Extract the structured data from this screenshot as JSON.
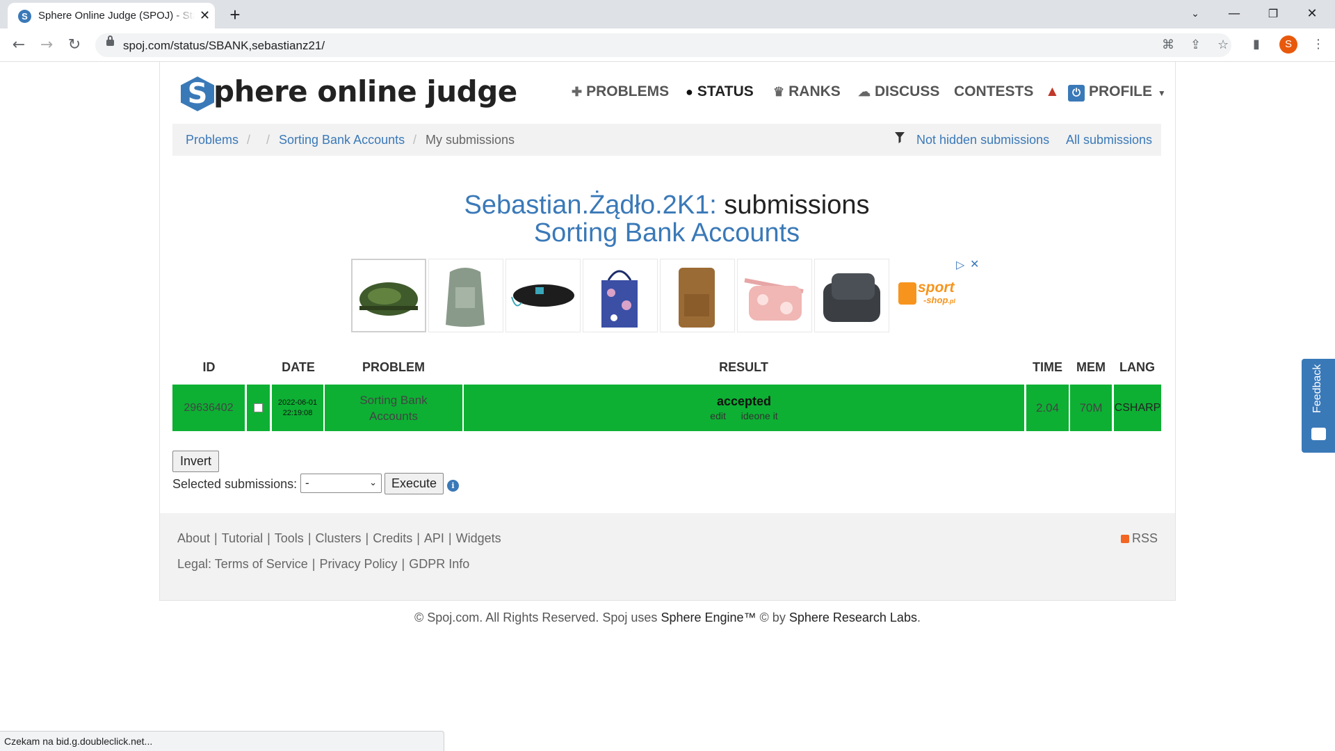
{
  "browser": {
    "tab_title": "Sphere Online Judge (SPOJ) - Status",
    "tab_favicon": "S",
    "new_tab_icon": "+",
    "url": "spoj.com/status/SBANK,sebastianz21/",
    "profile_initial": "S",
    "status_text": "Czekam na bid.g.doubleclick.net..."
  },
  "site": {
    "logo_letter": "S",
    "logo_text": "phere online judge",
    "nav": {
      "problems": "PROBLEMS",
      "status": "STATUS",
      "ranks": "RANKS",
      "discuss": "DISCUSS",
      "contests": "CONTESTS",
      "profile": "PROFILE"
    }
  },
  "breadcrumb": {
    "problems": "Problems",
    "sep1": "/",
    "sep2": "/",
    "problem": "Sorting Bank Accounts",
    "sep3": "/",
    "current": "My submissions",
    "filter_not_hidden": "Not hidden submissions",
    "filter_all": "All submissions"
  },
  "heading": {
    "user": "Sebastian.Żądło.2K1:",
    "suffix": "submissions",
    "problem": "Sorting Bank Accounts"
  },
  "ad": {
    "brand_line1": "sport",
    "brand_line2": "-shop",
    "brand_suffix": ".pl"
  },
  "table": {
    "headers": {
      "id": "ID",
      "date": "DATE",
      "problem": "PROBLEM",
      "result": "RESULT",
      "time": "TIME",
      "mem": "MEM",
      "lang": "LANG"
    },
    "rows": [
      {
        "id": "29636402",
        "date_line1": "2022-06-01",
        "date_line2": "22:19:08",
        "problem_line1": "Sorting Bank",
        "problem_line2": "Accounts",
        "result": "accepted",
        "action_edit": "edit",
        "action_ideone": "ideone it",
        "time": "2.04",
        "mem": "70M",
        "lang": "CSHARP"
      }
    ]
  },
  "controls": {
    "invert": "Invert",
    "selected_label": "Selected submissions:",
    "selected_value": "-",
    "execute": "Execute",
    "info": "i"
  },
  "footer": {
    "links": [
      "About",
      "Tutorial",
      "Tools",
      "Clusters",
      "Credits",
      "API",
      "Widgets"
    ],
    "legal_label": "Legal:",
    "legal_links": [
      "Terms of Service",
      "Privacy Policy",
      "GDPR Info"
    ],
    "rss": "RSS",
    "copyright_prefix": "© Spoj.com. All Rights Reserved. Spoj uses",
    "sphere_engine": "Sphere Engine™",
    "copyright_mid": "© by",
    "sphere_labs": "Sphere Research Labs",
    "copyright_end": "."
  },
  "feedback": {
    "label": "Feedback"
  },
  "colors": {
    "accent": "#3a79b8",
    "accepted": "#0db033",
    "warning": "#c0392b"
  }
}
